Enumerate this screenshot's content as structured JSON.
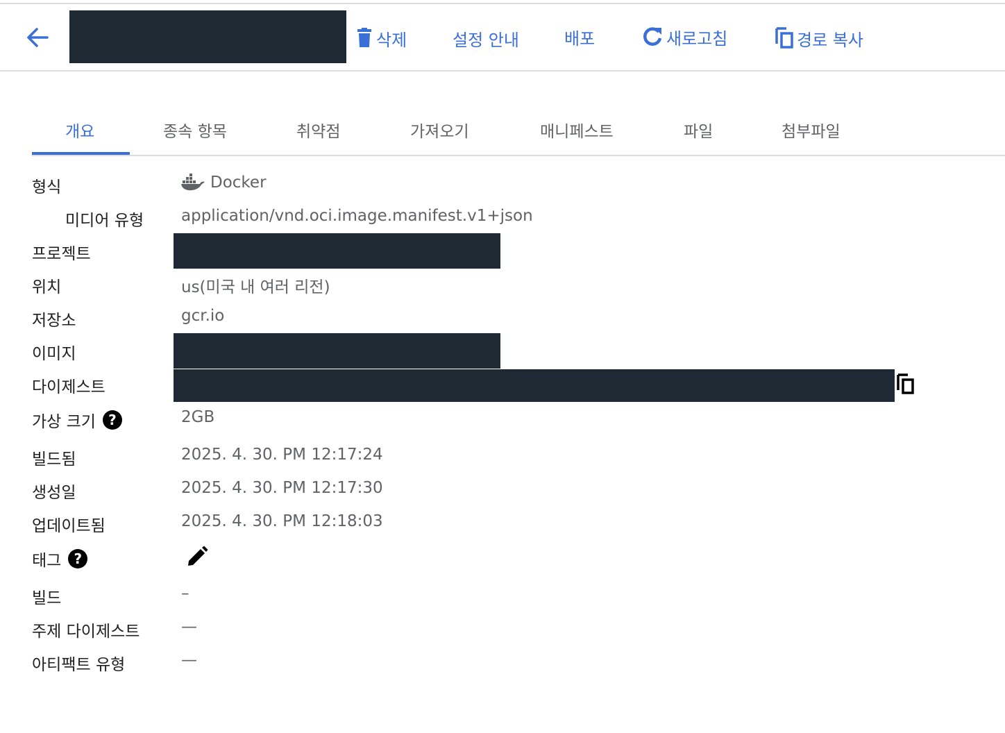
{
  "toolbar": {
    "delete_label": "삭제",
    "setup_label": "설정 안내",
    "deploy_label": "배포",
    "refresh_label": "새로고침",
    "copy_path_label": "경로 복사",
    "accent_color": "#3b6fd8"
  },
  "tabs": [
    {
      "label": "개요",
      "active": true
    },
    {
      "label": "종속 항목"
    },
    {
      "label": "취약점"
    },
    {
      "label": "가져오기"
    },
    {
      "label": "매니페스트"
    },
    {
      "label": "파일"
    },
    {
      "label": "첨부파일"
    }
  ],
  "details": {
    "format": {
      "label": "형식",
      "value": "Docker",
      "icon": "docker-icon"
    },
    "media_type": {
      "label": "미디어 유형",
      "value": "application/vnd.oci.image.manifest.v1+json"
    },
    "project": {
      "label": "프로젝트"
    },
    "location": {
      "label": "위치",
      "value": "us(미국 내 여러 리전)"
    },
    "repository": {
      "label": "저장소",
      "value": "gcr.io"
    },
    "image": {
      "label": "이미지"
    },
    "digest": {
      "label": "다이제스트"
    },
    "virtual_size": {
      "label": "가상 크기",
      "value": "2GB"
    },
    "built": {
      "label": "빌드됨",
      "value": "2025. 4. 30. PM 12:17:24"
    },
    "created": {
      "label": "생성일",
      "value": "2025. 4. 30. PM 12:17:30"
    },
    "updated": {
      "label": "업데이트됨",
      "value": "2025. 4. 30. PM 12:18:03"
    },
    "tags": {
      "label": "태그"
    },
    "build": {
      "label": "빌드",
      "value": "–"
    },
    "subject_digest": {
      "label": "주제 다이제스트",
      "value": "—"
    },
    "artifact_type": {
      "label": "아티팩트 유형",
      "value": "—"
    }
  }
}
